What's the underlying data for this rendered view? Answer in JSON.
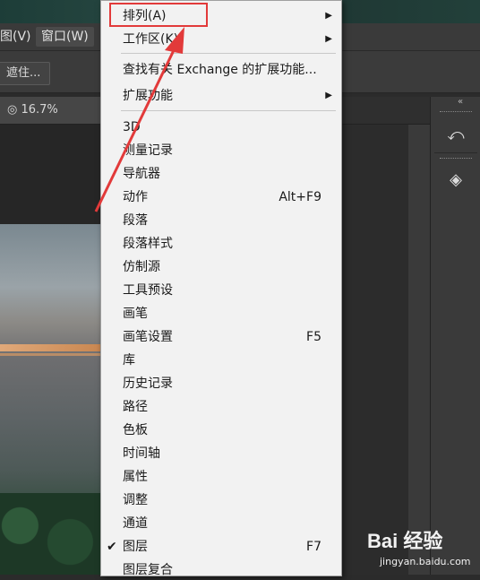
{
  "menubar": {
    "items": [
      {
        "label": "图(V)"
      },
      {
        "label": "窗口(W)"
      }
    ]
  },
  "options_bar": {
    "button_label": "遮住..."
  },
  "document": {
    "tab_label": "◎ 16.7%(RGB/8*)"
  },
  "window_menu": {
    "items": [
      {
        "label": "排列(A)",
        "submenu": true
      },
      {
        "label": "工作区(K)",
        "submenu": true
      },
      {
        "label": "查找有关 Exchange 的扩展功能...",
        "submenu": false
      },
      {
        "label": "扩展功能",
        "submenu": true
      },
      {
        "label": "3D"
      },
      {
        "label": "测量记录"
      },
      {
        "label": "导航器"
      },
      {
        "label": "动作",
        "shortcut": "Alt+F9"
      },
      {
        "label": "段落"
      },
      {
        "label": "段落样式"
      },
      {
        "label": "仿制源"
      },
      {
        "label": "工具预设"
      },
      {
        "label": "画笔"
      },
      {
        "label": "画笔设置",
        "shortcut": "F5"
      },
      {
        "label": "库"
      },
      {
        "label": "历史记录"
      },
      {
        "label": "路径"
      },
      {
        "label": "色板"
      },
      {
        "label": "时间轴"
      },
      {
        "label": "属性"
      },
      {
        "label": "调整"
      },
      {
        "label": "通道"
      },
      {
        "label": "图层",
        "shortcut": "F7",
        "checked": true
      },
      {
        "label": "图层复合"
      }
    ]
  },
  "right_panel": {
    "collapse_icon": "«",
    "buttons": [
      {
        "icon": "history-panel-icon",
        "glyph": "⤺"
      },
      {
        "icon": "3d-panel-icon",
        "glyph": "◈"
      }
    ]
  },
  "watermark": {
    "logo": "Bai 经验",
    "url": "jingyan.baidu.com"
  },
  "annotation": {
    "color": "#e23a3a"
  }
}
